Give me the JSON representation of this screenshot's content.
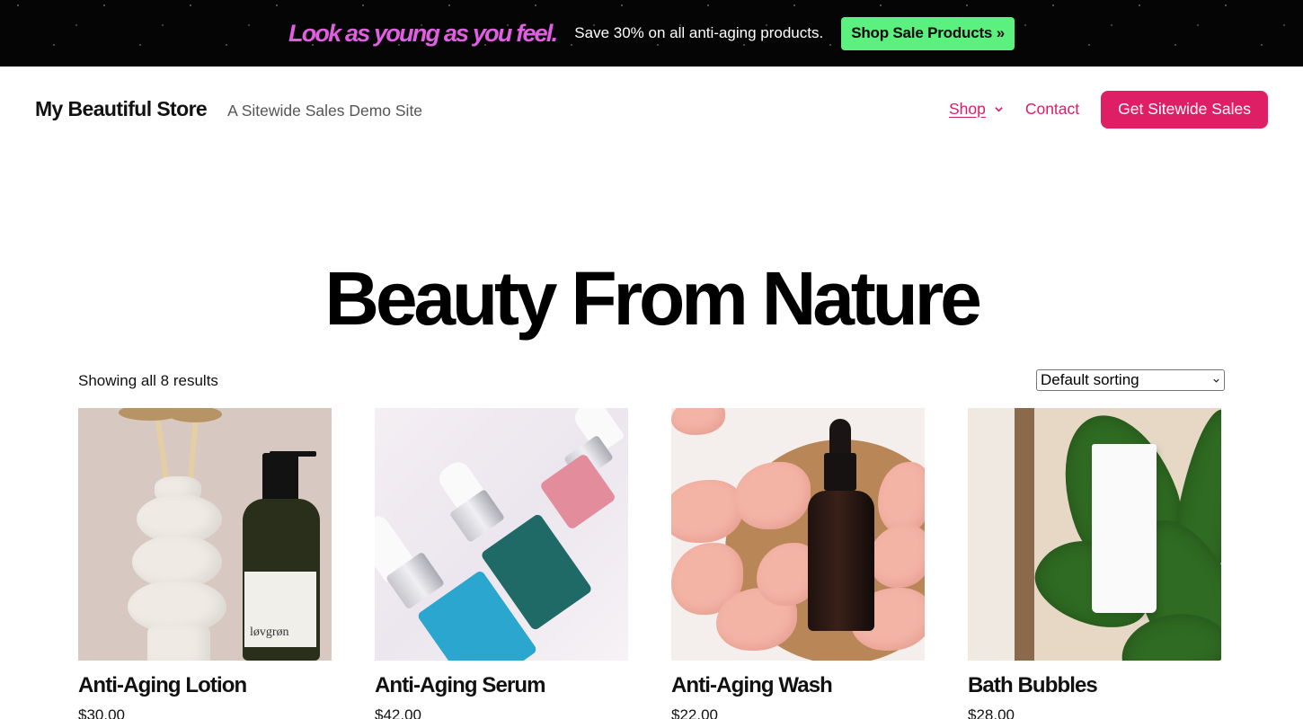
{
  "banner": {
    "headline": "Look as young as you feel.",
    "text": "Save 30% on all anti-aging products.",
    "button_label": "Shop Sale Products »",
    "colors": {
      "background": "#050505",
      "headline": "#e05ee0",
      "button": "#5cf07e"
    }
  },
  "header": {
    "site_title": "My Beautiful Store",
    "tagline": "A Sitewide Sales Demo Site",
    "nav": [
      {
        "label": "Shop",
        "has_dropdown": true,
        "icon": "chevron-down-icon"
      },
      {
        "label": "Contact"
      }
    ],
    "cta_label": "Get Sitewide Sales",
    "colors": {
      "accent": "#de1f66",
      "link": "#d61f69"
    }
  },
  "main": {
    "title": "Beauty From Nature",
    "result_count": "Showing all 8 results",
    "sort": {
      "selected": "Default sorting"
    },
    "products": [
      {
        "name": "Anti-Aging Lotion",
        "price": "$30.00",
        "image": "lotion-bottle-image"
      },
      {
        "name": "Anti-Aging Serum",
        "price": "$42.00",
        "image": "serum-vials-image"
      },
      {
        "name": "Anti-Aging Wash",
        "price": "$22.00",
        "image": "dropper-bottle-petals-image"
      },
      {
        "name": "Bath Bubbles",
        "price": "$28.00",
        "image": "tube-leaves-image"
      }
    ],
    "lotion_label_text": "løvgrøn"
  }
}
